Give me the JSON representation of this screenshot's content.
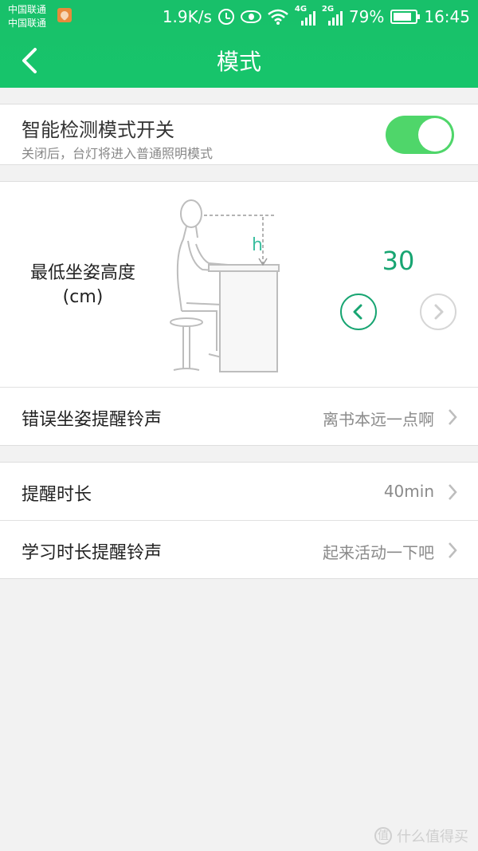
{
  "status_bar": {
    "carrier_1": "中国联通",
    "carrier_2": "中国联通",
    "net_speed": "1.9K/s",
    "sig_tag_1": "4G",
    "sig_tag_2": "2G",
    "battery_pct": "79%",
    "time": "16:45"
  },
  "header": {
    "title": "模式",
    "back_icon": "chevron-left-icon"
  },
  "smart_mode": {
    "title": "智能检测模式开关",
    "subtitle": "关闭后，台灯将进入普通照明模式",
    "enabled": true
  },
  "posture": {
    "label_line1": "最低坐姿高度",
    "label_line2": "(cm)",
    "h_marker": "h",
    "value": "30",
    "decrease_icon": "chevron-left-icon",
    "increase_icon": "chevron-right-icon"
  },
  "settings": {
    "wrong_posture_label": "错误坐姿提醒铃声",
    "wrong_posture_value": "离书本远一点啊",
    "remind_duration_label": "提醒时长",
    "remind_duration_value": "40min",
    "study_ringtone_label": "学习时长提醒铃声",
    "study_ringtone_value": "起来活动一下吧"
  },
  "watermark": {
    "text": "什么值得买",
    "logo": "值"
  },
  "colors": {
    "accent": "#18c06a",
    "toggle_on": "#4fd66a",
    "value_green": "#18a572"
  }
}
